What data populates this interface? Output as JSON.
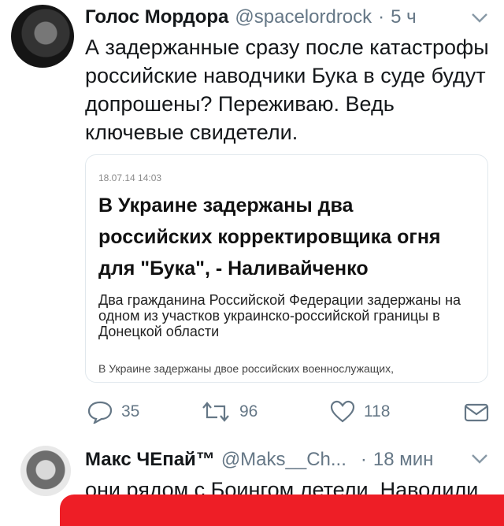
{
  "tweet1": {
    "author_name": "Голос Мордора",
    "handle": "@spacelordrock",
    "dot": "·",
    "time": "5 ч",
    "text": "А задержанные сразу после катастрофы российские наводчики Бука в суде будут допрошены? Переживаю. Ведь ключевые свидетели.",
    "card": {
      "date": "18.07.14 14:03",
      "title": "В Украине задержаны два российских корректировщика огня для \"Бука\", - Наливайченко",
      "description": "Два гражданина Российской Федерации задержаны на одном из участков украинско-российской границы в Донецкой области",
      "more": "В Украине задержаны двое российских военнослужащих,"
    },
    "actions": {
      "replies": "35",
      "retweets": "96",
      "likes": "118"
    }
  },
  "tweet2": {
    "author_name": "Макс ЧЕпай™",
    "handle": "@Maks__Ch...",
    "dot": "·",
    "time": "18 мин",
    "text": "они рядом с Боингом летели. Наводили."
  },
  "colors": {
    "muted": "#657786",
    "border": "#e1e8ed",
    "highlight": "#ee1e26"
  },
  "icons": [
    "reply-icon",
    "retweet-icon",
    "like-icon",
    "message-icon",
    "chevron-down-icon"
  ]
}
